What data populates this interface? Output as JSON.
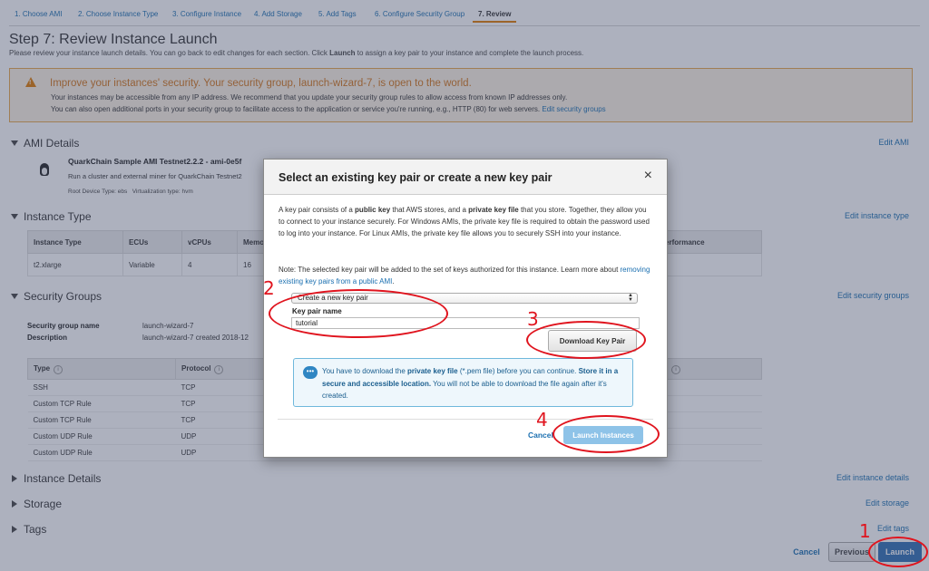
{
  "wizard": {
    "tabs": [
      "1. Choose AMI",
      "2. Choose Instance Type",
      "3. Configure Instance",
      "4. Add Storage",
      "5. Add Tags",
      "6. Configure Security Group",
      "7. Review"
    ]
  },
  "page": {
    "title": "Step 7: Review Instance Launch",
    "subtitle_before": "Please review your instance launch details. You can go back to edit changes for each section. Click ",
    "subtitle_bold": "Launch",
    "subtitle_after": " to assign a key pair to your instance and complete the launch process."
  },
  "warning": {
    "title": "Improve your instances' security. Your security group, launch-wizard-7, is open to the world.",
    "line1": "Your instances may be accessible from any IP address. We recommend that you update your security group rules to allow access from known IP addresses only.",
    "line2": "You can also open additional ports in your security group to facilitate access to the application or service you're running, e.g., HTTP (80) for web servers.",
    "link": "Edit security groups"
  },
  "ami": {
    "section": "AMI Details",
    "edit": "Edit AMI",
    "name": "QuarkChain Sample AMI Testnet2.2.2 - ami-0e5f",
    "desc": "Run a cluster and external miner for QuarkChain Testnet2",
    "root_device": "Root Device Type: ebs",
    "virt": "Virtualization type: hvm"
  },
  "instance_type": {
    "section": "Instance Type",
    "edit": "Edit instance type",
    "headers": [
      "Instance Type",
      "ECUs",
      "vCPUs",
      "Memo",
      "erformance"
    ],
    "row": [
      "t2.xlarge",
      "Variable",
      "4",
      "16"
    ]
  },
  "security_groups": {
    "section": "Security Groups",
    "edit": "Edit security groups",
    "name_label": "Security group name",
    "name_value": "launch-wizard-7",
    "desc_label": "Description",
    "desc_value": "launch-wizard-7 created 2018-12",
    "headers": [
      "Type",
      "Protocol"
    ],
    "rows": [
      [
        "SSH",
        "TCP"
      ],
      [
        "Custom TCP Rule",
        "TCP"
      ],
      [
        "Custom TCP Rule",
        "TCP"
      ],
      [
        "Custom UDP Rule",
        "UDP"
      ],
      [
        "Custom UDP Rule",
        "UDP"
      ]
    ]
  },
  "collapsed_sections": [
    {
      "title": "Instance Details",
      "edit": "Edit instance details"
    },
    {
      "title": "Storage",
      "edit": "Edit storage"
    },
    {
      "title": "Tags",
      "edit": "Edit tags"
    }
  ],
  "footer": {
    "cancel": "Cancel",
    "previous": "Previous",
    "launch": "Launch"
  },
  "modal": {
    "title": "Select an existing key pair or create a new key pair",
    "close": "×",
    "p1_parts": [
      "A key pair consists of a ",
      "public key",
      " that AWS stores, and a ",
      "private key file",
      " that you store. Together, they allow you to connect to your instance securely. For Windows AMIs, the private key file is required to obtain the password used to log into your instance. For Linux AMIs, the private key file allows you to securely SSH into your instance."
    ],
    "note": "Note: The selected key pair will be added to the set of keys authorized for this instance. Learn more about ",
    "note_link": "removing existing key pairs from a public AMI",
    "note_end": ".",
    "select_value": "Create a new key pair",
    "key_pair_label": "Key pair name",
    "key_pair_value": "tutorial",
    "download_button": "Download Key Pair",
    "info_parts": [
      "You have to download the ",
      "private key file",
      " (*.pem file) before you can continue. ",
      "Store it in a secure and accessible location.",
      " You will not be able to download the file again after it's created."
    ],
    "cancel": "Cancel",
    "launch_instances": "Launch Instances"
  },
  "annotations": [
    "1",
    "2",
    "3",
    "4"
  ],
  "colors": {
    "annotation": "#e0141e",
    "link": "#1a6fb0",
    "warning": "#d4761a",
    "launch": "#2f6fb4"
  }
}
